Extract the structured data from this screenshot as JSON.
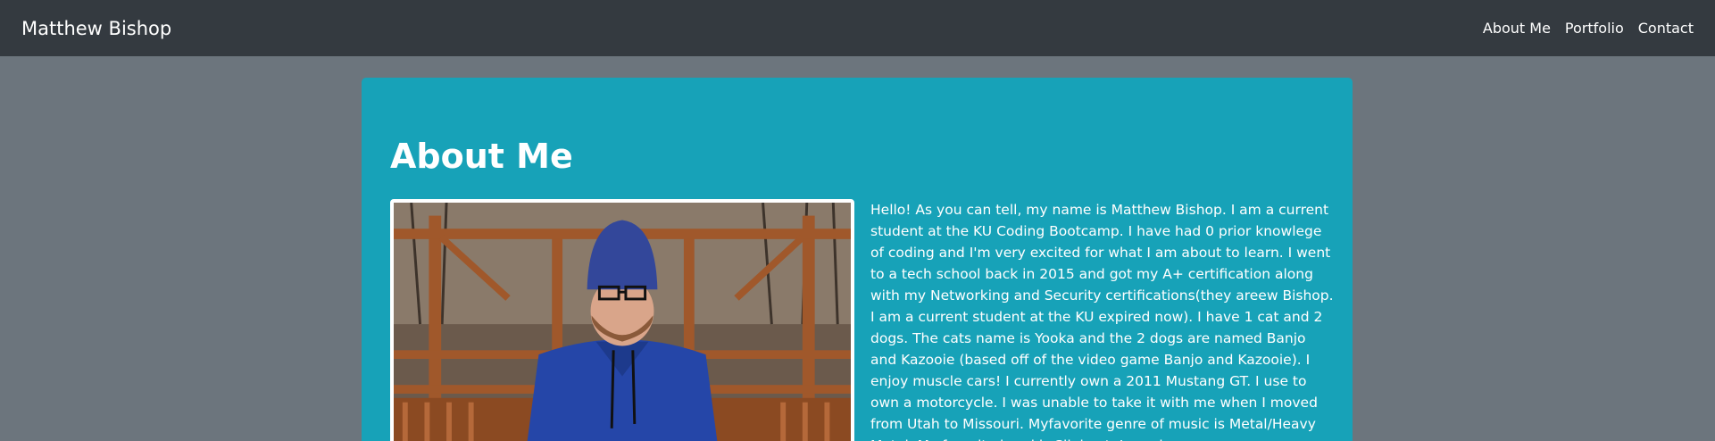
{
  "navbar": {
    "brand": "Matthew Bishop",
    "links": [
      "About Me",
      "Portfolio",
      "Contact"
    ]
  },
  "main": {
    "title": "About Me",
    "bio": "Hello! As you can tell, my name is Matthew Bishop. I am a current student at the KU Coding Bootcamp. I have had 0 prior knowlege of coding and I'm very excited for what I am about to learn. I went to a tech school back in 2015 and got my A+ certification along with my Networking and Security certifications(they areew Bishop. I am a current student at the KU expired now). I have 1 cat and 2 dogs. The cats name is Yooka and the 2 dogs are named Banjo and Kazooie (based off of the video game Banjo and Kazooie). I enjoy muscle cars! I currently own a 2011 Mustang GT. I use to own a motorcycle. I was unable to take it with me when I moved from Utah to Missouri. Myfavorite genre of music is Metal/Heavy Metal. My favorite band is Slipknot. I was born"
  },
  "colors": {
    "navbar_bg": "#343a40",
    "page_bg": "#6c757d",
    "card_bg": "#17a2b8",
    "text": "#ffffff"
  }
}
